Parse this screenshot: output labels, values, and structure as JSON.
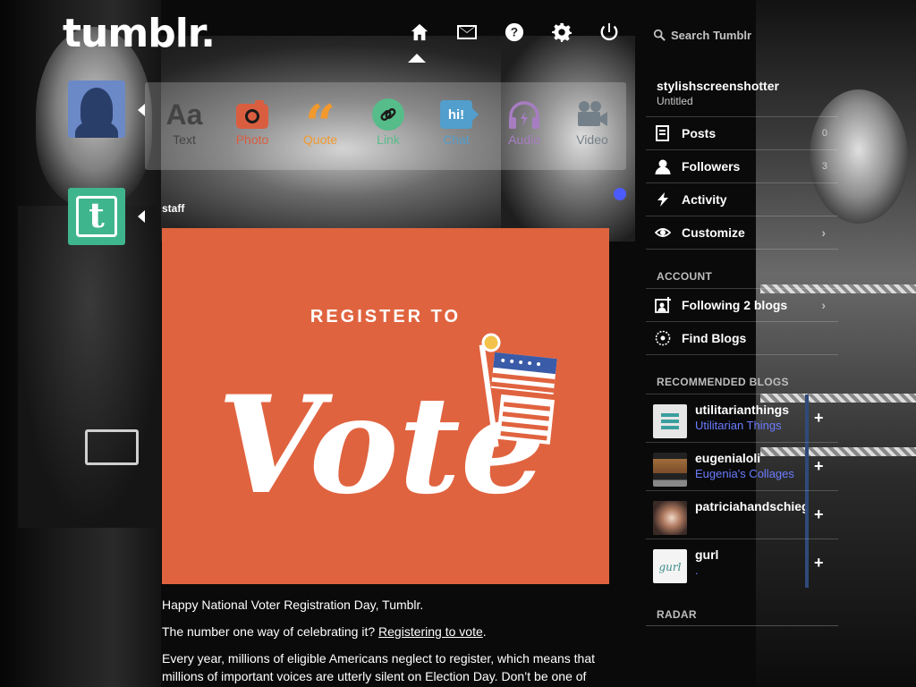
{
  "header": {
    "logo": "tumblr.",
    "nav": [
      "home-icon",
      "envelope-icon",
      "help-icon",
      "gear-icon",
      "power-icon"
    ],
    "search_placeholder": "Search Tumblr"
  },
  "post_types": [
    {
      "label": "Text",
      "color": "#444444"
    },
    {
      "label": "Photo",
      "color": "#d95e40"
    },
    {
      "label": "Quote",
      "color": "#f2992e"
    },
    {
      "label": "Link",
      "color": "#56bc8a"
    },
    {
      "label": "Chat",
      "color": "#529ecc"
    },
    {
      "label": "Audio",
      "color": "#a77dc2"
    },
    {
      "label": "Video",
      "color": "#748089"
    }
  ],
  "post": {
    "author": "staff",
    "image_heading": "REGISTER TO",
    "image_word": "Vote",
    "paragraphs": {
      "p1": "Happy National Voter Registration Day, Tumblr.",
      "p2_prefix": "The number one way of celebrating it?",
      "p2_link": "Registering to vote",
      "p2_suffix": ".",
      "p3": "Every year, millions of eligible Americans neglect to register, which means that millions of important voices are utterly silent on Election Day. Don’t be one of"
    }
  },
  "sidebar": {
    "blog_name": "stylishscreenshotter",
    "blog_title": "Untitled",
    "items": [
      {
        "label": "Posts",
        "count": "0"
      },
      {
        "label": "Followers",
        "count": "3"
      },
      {
        "label": "Activity"
      },
      {
        "label": "Customize",
        "chevron": "›"
      }
    ],
    "account_heading": "ACCOUNT",
    "account_items": [
      {
        "label": "Following 2 blogs",
        "chevron": "›"
      },
      {
        "label": "Find Blogs"
      }
    ],
    "recommended_heading": "RECOMMENDED BLOGS",
    "recommended": [
      {
        "name": "utilitarianthings",
        "title": "Utilitarian Things",
        "plus": "+"
      },
      {
        "name": "eugenialoli",
        "title": "Eugenia's Collages",
        "plus": "+"
      },
      {
        "name": "patriciahandschiegel",
        "title": "",
        "plus": "+"
      },
      {
        "name": "gurl",
        "title": ".",
        "plus": "+"
      }
    ],
    "radar_heading": "RADAR"
  }
}
